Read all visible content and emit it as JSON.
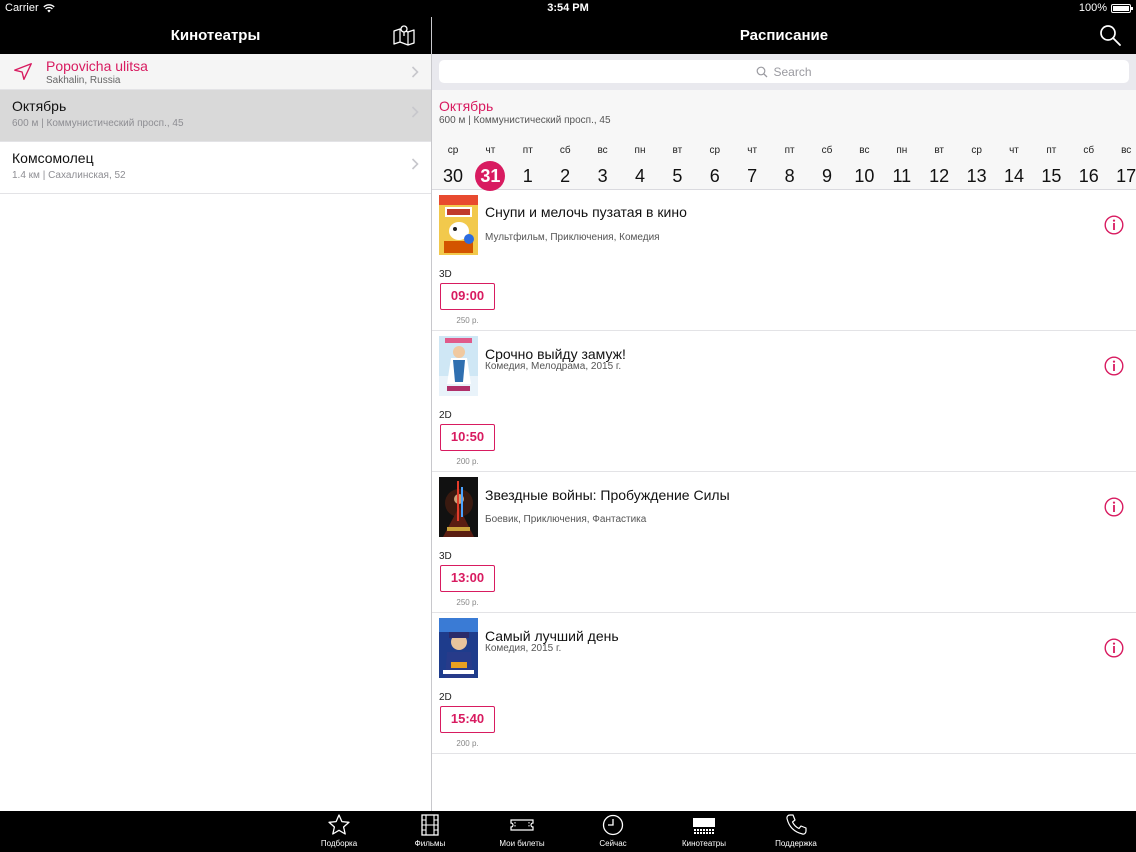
{
  "status_bar": {
    "carrier": "Carrier",
    "time": "3:54 PM",
    "battery": "100%"
  },
  "left": {
    "title": "Кинотеатры",
    "location": {
      "name": "Popovicha ulitsa",
      "sub": "Sakhalin, Russia"
    },
    "cinemas": [
      {
        "name": "Октябрь",
        "sub": "600 м | Коммунистический просп., 45"
      },
      {
        "name": "Комсомолец",
        "sub": "1.4 км | Сахалинская, 52"
      }
    ]
  },
  "right": {
    "title": "Расписание",
    "search": {
      "placeholder": "Search"
    },
    "cinema": {
      "name": "Октябрь",
      "address": "600 м | Коммунистический просп., 45"
    },
    "dates": [
      {
        "dow": "ср",
        "num": "30"
      },
      {
        "dow": "чт",
        "num": "31",
        "selected": true
      },
      {
        "dow": "пт",
        "num": "1"
      },
      {
        "dow": "сб",
        "num": "2"
      },
      {
        "dow": "вс",
        "num": "3"
      },
      {
        "dow": "пн",
        "num": "4"
      },
      {
        "dow": "вт",
        "num": "5"
      },
      {
        "dow": "ср",
        "num": "6"
      },
      {
        "dow": "чт",
        "num": "7"
      },
      {
        "dow": "пт",
        "num": "8"
      },
      {
        "dow": "сб",
        "num": "9"
      },
      {
        "dow": "вс",
        "num": "10"
      },
      {
        "dow": "пн",
        "num": "11"
      },
      {
        "dow": "вт",
        "num": "12"
      },
      {
        "dow": "ср",
        "num": "13"
      },
      {
        "dow": "чт",
        "num": "14"
      },
      {
        "dow": "пт",
        "num": "15"
      },
      {
        "dow": "сб",
        "num": "16"
      },
      {
        "dow": "вс",
        "num": "17"
      }
    ],
    "movies": [
      {
        "title": "Снупи и мелочь пузатая в кино",
        "genres": "Мультфильм, Приключения, Комедия",
        "format": "3D",
        "time": "09:00",
        "price": "250 р."
      },
      {
        "title": "Срочно выйду замуж!",
        "genres": "Комедия, Мелодрама, 2015 г.",
        "format": "2D",
        "time": "10:50",
        "price": "200 р."
      },
      {
        "title": "Звездные войны: Пробуждение Силы",
        "genres": "Боевик, Приключения, Фантастика",
        "format": "3D",
        "time": "13:00",
        "price": "250 р."
      },
      {
        "title": "Самый лучший день",
        "genres": "Комедия, 2015 г.",
        "format": "2D",
        "time": "15:40",
        "price": "200 р."
      }
    ]
  },
  "tabs": [
    {
      "label": "Подборка",
      "icon": "star-icon"
    },
    {
      "label": "Фильмы",
      "icon": "film-icon"
    },
    {
      "label": "Мои билеты",
      "icon": "ticket-icon"
    },
    {
      "label": "Сейчас",
      "icon": "clock-icon"
    },
    {
      "label": "Кинотеатры",
      "icon": "cinema-icon",
      "active": true
    },
    {
      "label": "Поддержка",
      "icon": "phone-icon"
    }
  ],
  "colors": {
    "accent": "#d81b60",
    "bar": "#000000"
  }
}
